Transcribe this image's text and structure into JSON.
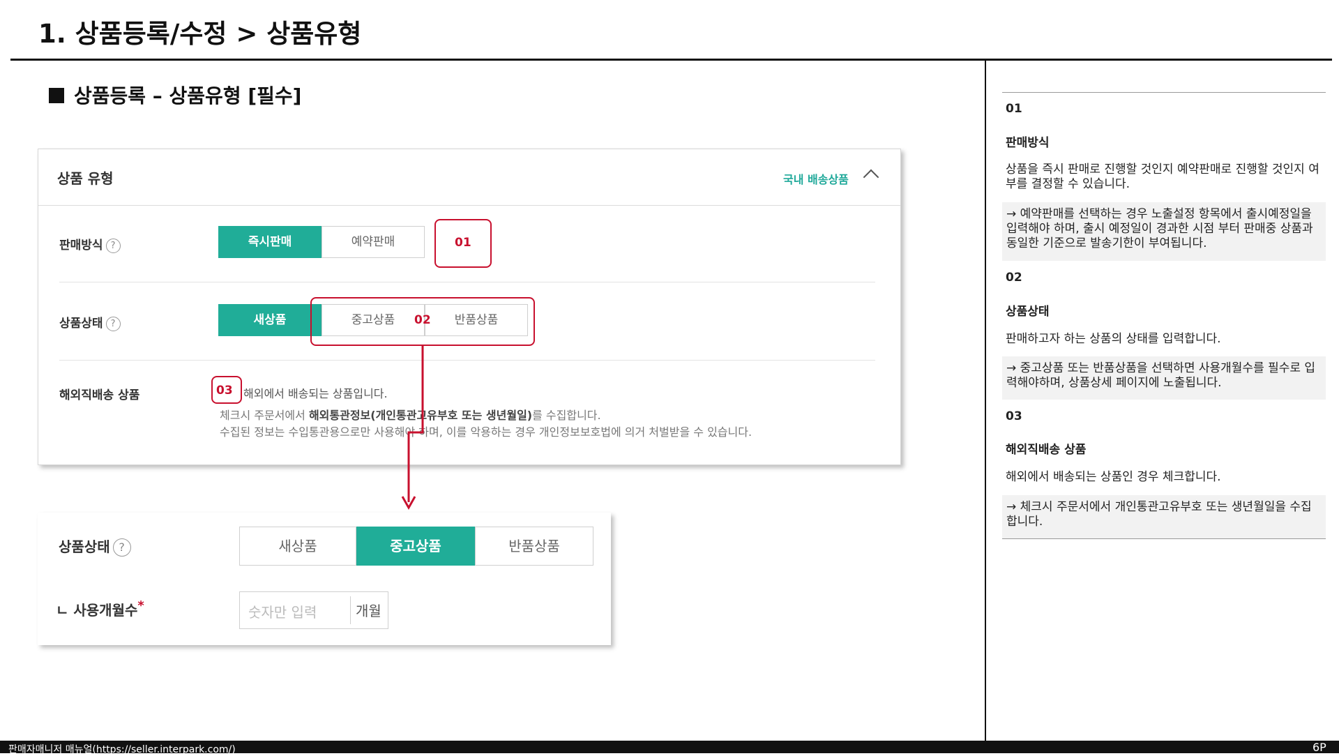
{
  "page": {
    "title": "1. 상품등록/수정 > 상품유형",
    "section_heading": "상품등록 – 상품유형 [필수]"
  },
  "panel": {
    "title": "상품 유형",
    "domestic_link": "국내 배송상품",
    "help_glyph": "?",
    "rows": {
      "sales_method": {
        "label": "판매방식",
        "options": [
          "즉시판매",
          "예약판매"
        ],
        "selected": "즉시판매",
        "marker": "01"
      },
      "product_condition": {
        "label": "상품상태",
        "options": [
          "새상품",
          "중고상품",
          "반품상품"
        ],
        "selected": "새상품",
        "marker": "02"
      },
      "overseas": {
        "label": "해외직배송 상품",
        "marker": "03",
        "checkbox_text": "해외에서 배송되는 상품입니다.",
        "note1_pre": "체크시 주문서에서 ",
        "note1_bold": "해외통관정보(개인통관고유부호 또는 생년월일)",
        "note1_post": "를 수집합니다.",
        "note2": "수집된 정보는 수입통관용으로만 사용해야 하며, 이를 악용하는 경우 개인정보보호법에 의거 처벌받을 수 있습니다."
      }
    }
  },
  "zoom_panel": {
    "label": "상품상태",
    "options": [
      "새상품",
      "중고상품",
      "반품상품"
    ],
    "selected": "중고상품",
    "months_label": "ㄴ 사용개월수",
    "required_mark": "*",
    "months_placeholder": "숫자만 입력",
    "months_unit": "개월"
  },
  "notes": [
    {
      "num": "01",
      "heading": "판매방식",
      "text": "상품을 즉시 판매로 진행할 것인지 예약판매로 진행할 것인지 여부를 결정할 수 있습니다.",
      "detail": "→ 예약판매를 선택하는 경우 노출설정 항목에서 출시예정일을 입력해야 하며, 출시 예정일이 경과한 시점 부터 판매중 상품과 동일한 기준으로 발송기한이 부여됩니다."
    },
    {
      "num": "02",
      "heading": "상품상태",
      "text": "판매하고자 하는 상품의 상태를 입력합니다.",
      "detail": "→ 중고상품 또는 반품상품을 선택하면 사용개월수를 필수로 입력해야하며, 상품상세 페이지에 노출됩니다."
    },
    {
      "num": "03",
      "heading": "해외직배송 상품",
      "text": "해외에서 배송되는 상품인 경우 체크합니다.",
      "detail": "→ 체크시 주문서에서 개인통관고유부호 또는 생년월일을 수집합니다."
    }
  ],
  "footer": {
    "text": "판매자매니저 매뉴얼(https://seller.interpark.com/)",
    "page_number": "6P"
  },
  "colors": {
    "accent": "#20ad98",
    "callout": "#c8102e",
    "link": "#20a99a"
  }
}
